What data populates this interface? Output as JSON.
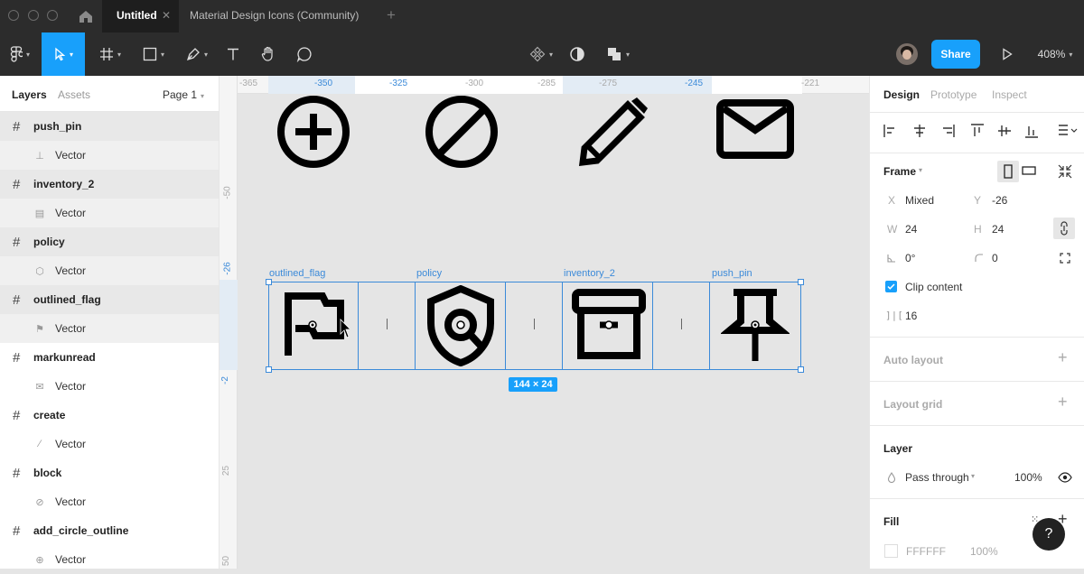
{
  "tabs": {
    "active": "Untitled",
    "other": "Material Design Icons (Community)"
  },
  "toolbar": {
    "zoom": "408%",
    "share": "Share"
  },
  "sidebar": {
    "tab_layers": "Layers",
    "tab_assets": "Assets",
    "page": "Page 1",
    "items": [
      {
        "name": "push_pin",
        "child": "Vector"
      },
      {
        "name": "inventory_2",
        "child": "Vector"
      },
      {
        "name": "policy",
        "child": "Vector"
      },
      {
        "name": "outlined_flag",
        "child": "Vector"
      },
      {
        "name": "markunread",
        "child": "Vector"
      },
      {
        "name": "create",
        "child": "Vector"
      },
      {
        "name": "block",
        "child": "Vector"
      },
      {
        "name": "add_circle_outline",
        "child": "Vector"
      }
    ]
  },
  "canvas": {
    "ruler_top": [
      "-365",
      "-350",
      "-325",
      "-300",
      "-285",
      "-275",
      "-245",
      "-221"
    ],
    "ruler_left": [
      "-50",
      "-26",
      "-2",
      "25",
      "50"
    ],
    "frame_labels": [
      "outlined_flag",
      "policy",
      "inventory_2",
      "push_pin"
    ],
    "size_badge": "144 × 24"
  },
  "design": {
    "tabs": [
      "Design",
      "Prototype",
      "Inspect"
    ],
    "frame_title": "Frame",
    "x_label": "X",
    "x_value": "Mixed",
    "y_label": "Y",
    "y_value": "-26",
    "w_label": "W",
    "w_value": "24",
    "h_label": "H",
    "h_value": "24",
    "rotation": "0°",
    "radius": "0",
    "clip_content": "Clip content",
    "spacing": "16",
    "auto_layout": "Auto layout",
    "layout_grid": "Layout grid",
    "layer_title": "Layer",
    "blend": "Pass through",
    "opacity": "100%",
    "fill_title": "Fill",
    "fill_hex": "FFFFFF",
    "fill_opacity": "100%",
    "help": "?"
  },
  "colors": {
    "accent": "#18a0fb",
    "selection": "#3b8ad9",
    "dark": "#2c2c2c"
  }
}
